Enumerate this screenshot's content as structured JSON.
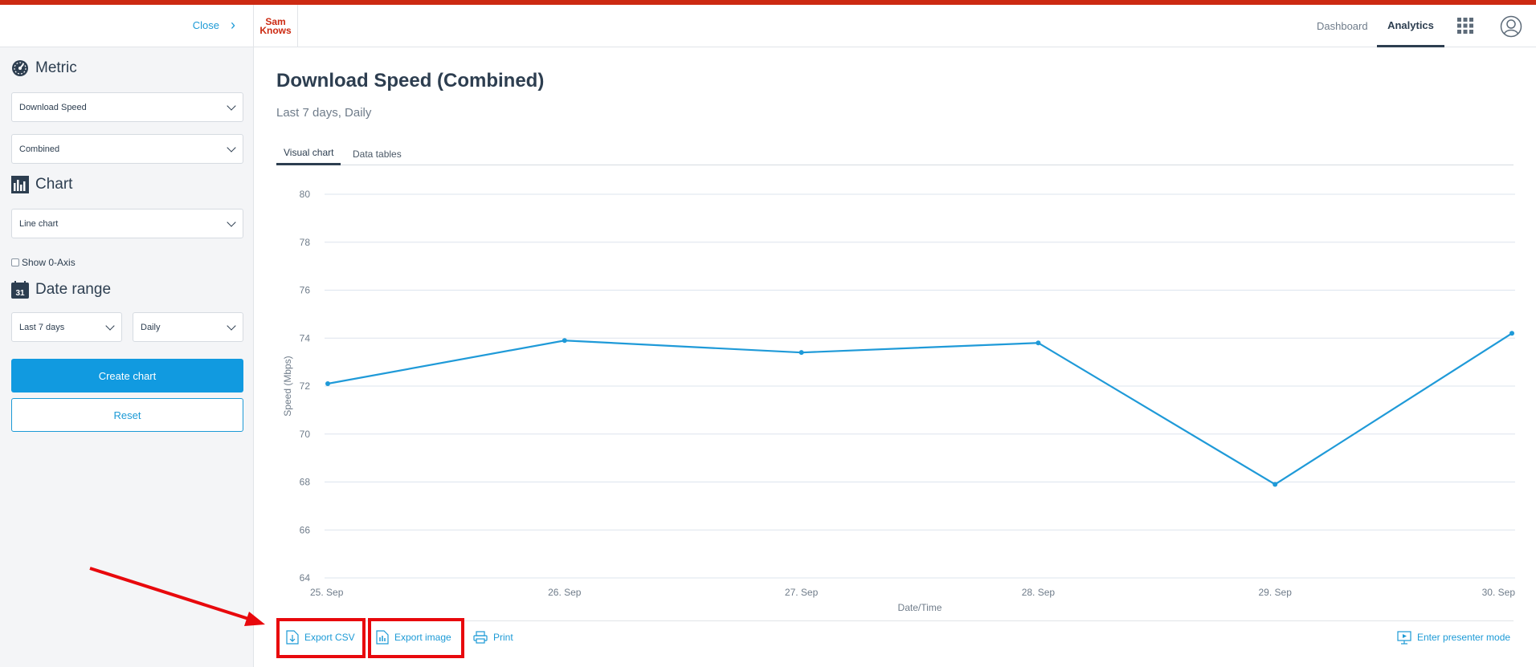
{
  "sidebar": {
    "close_label": "Close",
    "metric_title": "Metric",
    "metric_select": "Download Speed",
    "direction_select": "Combined",
    "chart_title": "Chart",
    "chart_type_select": "Line chart",
    "show_axis_label": "Show 0-Axis",
    "date_range_title": "Date range",
    "calendar_day": "31",
    "range_select": "Last 7 days",
    "interval_select": "Daily",
    "create_button": "Create chart",
    "reset_button": "Reset"
  },
  "header": {
    "logo_line1": "Sam",
    "logo_line2": "Knows",
    "nav_dashboard": "Dashboard",
    "nav_analytics": "Analytics"
  },
  "main": {
    "title": "Download Speed (Combined)",
    "subtitle": "Last 7 days, Daily",
    "tab_visual": "Visual chart",
    "tab_data": "Data tables"
  },
  "actions": {
    "export_csv": "Export CSV",
    "export_image": "Export image",
    "print": "Print",
    "presenter": "Enter presenter mode"
  },
  "colors": {
    "accent": "#cc2a12",
    "primary": "#119ae0",
    "line": "#1f9ad8",
    "annotation": "#e8090d"
  },
  "chart_data": {
    "type": "line",
    "categories": [
      "25. Sep",
      "26. Sep",
      "27. Sep",
      "28. Sep",
      "29. Sep",
      "30. Sep"
    ],
    "series": [
      {
        "values": [
          72.1,
          73.9,
          73.4,
          73.8,
          67.9,
          74.2
        ]
      }
    ],
    "xlabel": "Date/Time",
    "ylabel": "Speed (Mbps)",
    "ylim": [
      64,
      80
    ],
    "yticks": [
      64,
      66,
      68,
      70,
      72,
      74,
      76,
      78,
      80
    ],
    "grid": true
  }
}
